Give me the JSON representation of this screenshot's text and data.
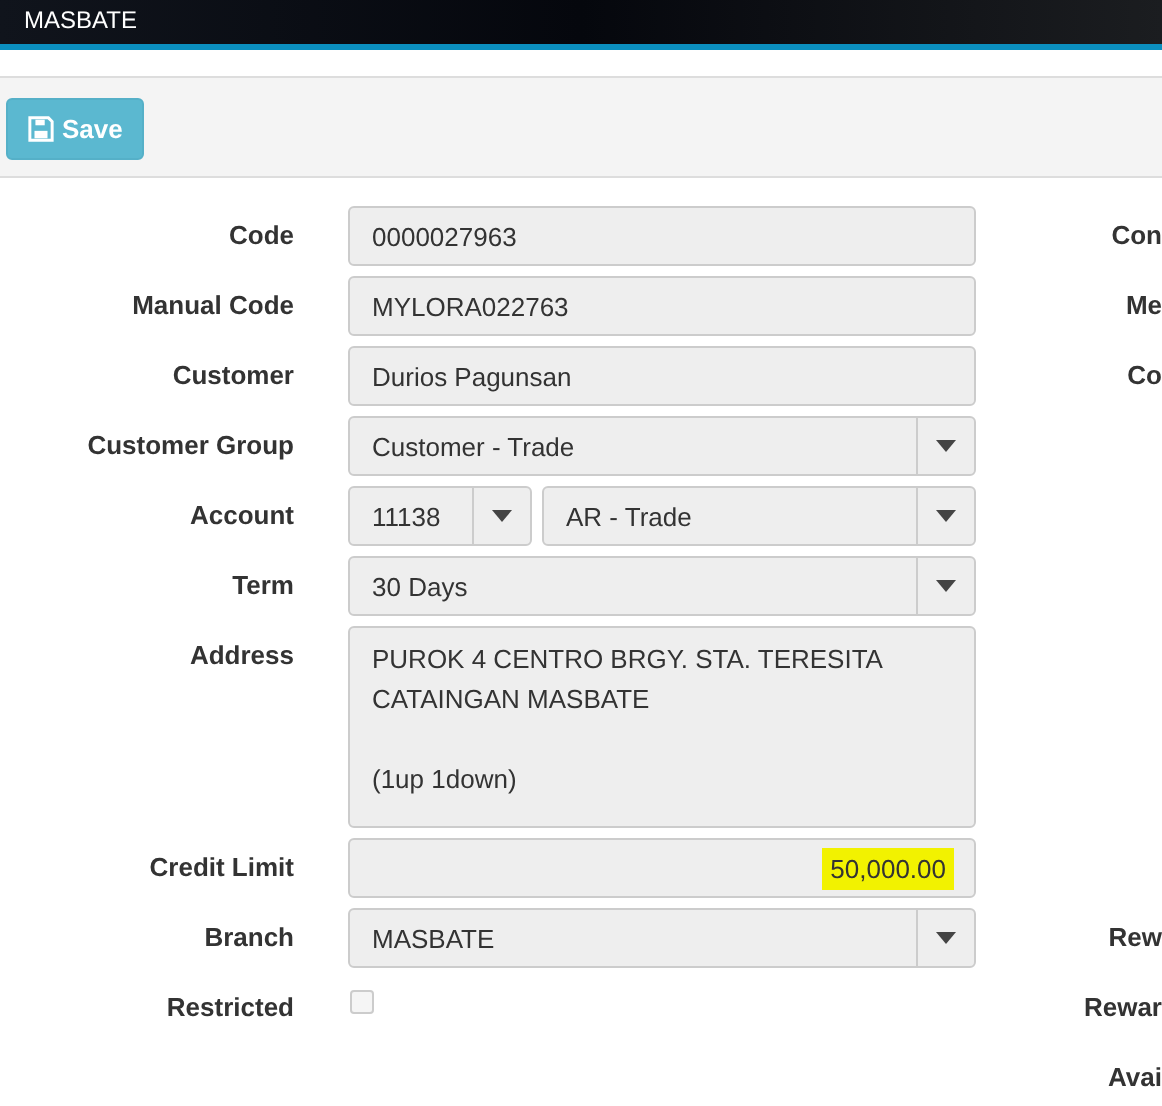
{
  "header": {
    "title": "MASBATE"
  },
  "toolbar": {
    "save_button": "Save"
  },
  "fields": [
    {
      "label": "Code",
      "kind": "text",
      "value": "0000027963",
      "right_label": "Con"
    },
    {
      "label": "Manual Code",
      "kind": "text",
      "value": "MYLORA022763",
      "right_label": "Me"
    },
    {
      "label": "Customer",
      "kind": "text",
      "value": "Durios Pagunsan",
      "right_label": "Co"
    },
    {
      "label": "Customer Group",
      "kind": "select",
      "value": "Customer - Trade"
    },
    {
      "label": "Account",
      "kind": "account",
      "value": "11138",
      "value_2": "AR - Trade"
    },
    {
      "label": "Term",
      "kind": "select",
      "value": "30 Days"
    },
    {
      "label": "Address",
      "kind": "textarea",
      "lines": [
        "PUROK 4 CENTRO BRGY. STA. TERESITA",
        "CATAINGAN MASBATE"
      ],
      "note": "(1up 1down)"
    },
    {
      "label": "Credit Limit",
      "kind": "number",
      "value": "50,000.00",
      "highlighted": true
    },
    {
      "label": "Branch",
      "kind": "select",
      "value": "MASBATE",
      "right_label": "Rew"
    },
    {
      "label": "Restricted",
      "kind": "checkbox",
      "checked": false,
      "right_label": "Rewar"
    },
    {
      "kind": "empty",
      "right_label": "Avai"
    }
  ]
}
